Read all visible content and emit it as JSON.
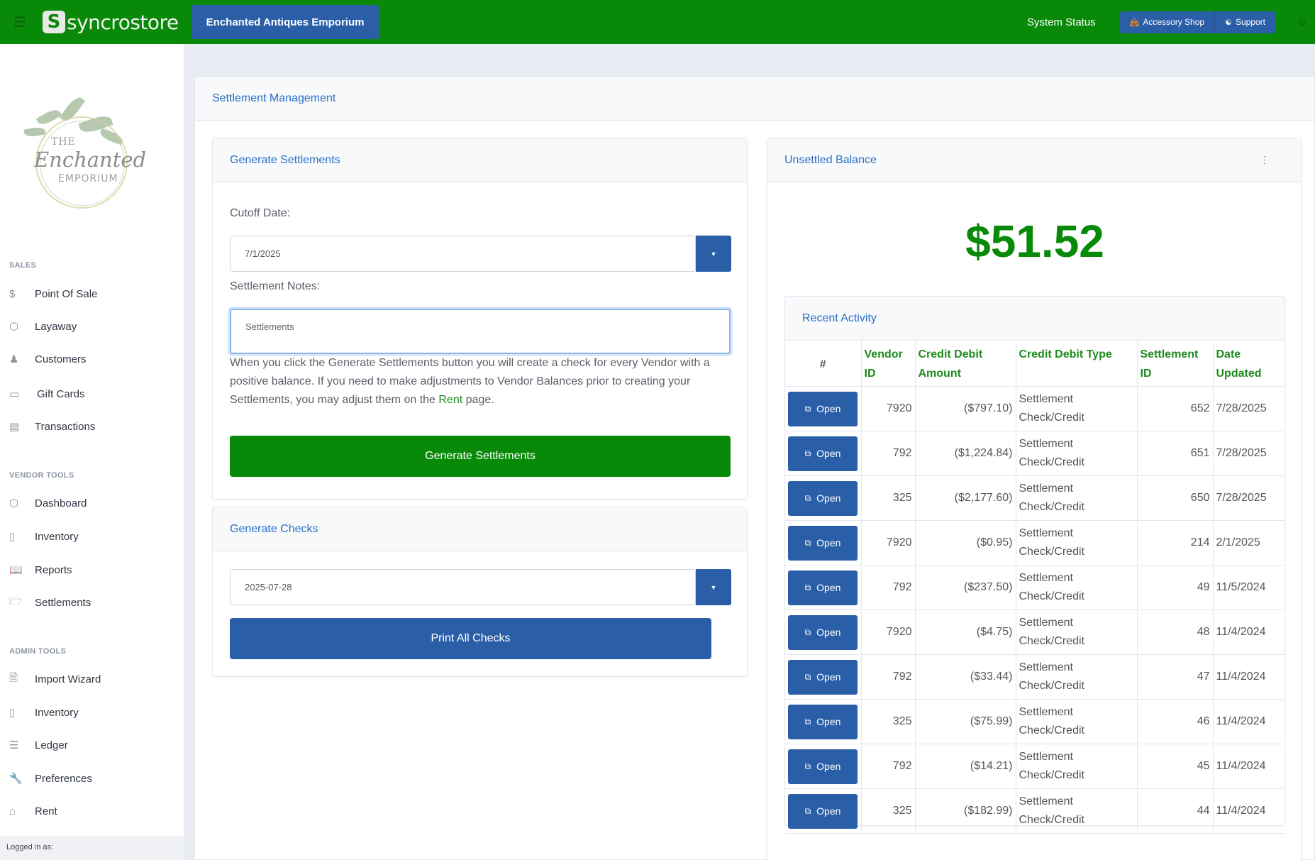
{
  "topbar": {
    "brand": "syncrostore",
    "brand_mark": "S",
    "store_name": "Enchanted Antiques Emporium",
    "system_status": "System Status",
    "accessory_shop": "Accessory Shop",
    "support": "Support",
    "accent": "#088a08",
    "button_color": "#2a5fa8"
  },
  "logo": {
    "the": "THE",
    "enchanted": "Enchanted",
    "emporium": "EMPORIUM"
  },
  "sidebar": {
    "sections": [
      {
        "title": "SALES",
        "items": [
          {
            "label": "Point Of Sale",
            "icon": "dollar-icon"
          },
          {
            "label": "Layaway",
            "icon": "box-icon"
          },
          {
            "label": "Customers",
            "icon": "users-icon"
          },
          {
            "label": "Gift Cards",
            "icon": "card-icon"
          },
          {
            "label": "Transactions",
            "icon": "database-icon"
          }
        ]
      },
      {
        "title": "VENDOR TOOLS",
        "items": [
          {
            "label": "Dashboard",
            "icon": "box-icon"
          },
          {
            "label": "Inventory",
            "icon": "book-icon"
          },
          {
            "label": "Reports",
            "icon": "open-book-icon"
          },
          {
            "label": "Settlements",
            "icon": "folder-icon"
          }
        ]
      },
      {
        "title": "ADMIN TOOLS",
        "items": [
          {
            "label": "Import Wizard",
            "icon": "file-icon"
          },
          {
            "label": "Inventory",
            "icon": "book-icon"
          },
          {
            "label": "Ledger",
            "icon": "layers-icon"
          },
          {
            "label": "Preferences",
            "icon": "wrench-icon"
          },
          {
            "label": "Rent",
            "icon": "home-icon"
          }
        ]
      }
    ],
    "logged_in": "Logged in as:"
  },
  "main": {
    "title": "Settlement Management",
    "generate_settlements": {
      "title": "Generate Settlements",
      "cutoff_label": "Cutoff Date:",
      "cutoff_value": "7/1/2025",
      "notes_label": "Settlement Notes:",
      "notes_value": "Settlements",
      "help_before": "When you click the Generate Settlements button you will create a check for every Vendor with a positive balance. If you need to make adjustments to Vendor Balances prior to creating your Settlements, you may adjust them on the ",
      "help_link": "Rent",
      "help_after": " page.",
      "button": "Generate Settlements"
    },
    "generate_checks": {
      "title": "Generate Checks",
      "date_value": "2025-07-28",
      "button": "Print All Checks"
    },
    "unsettled": {
      "title": "Unsettled Balance",
      "amount": "$51.52"
    },
    "recent_activity": {
      "title": "Recent Activity",
      "columns": [
        "#",
        "Vendor ID",
        "Credit Debit Amount",
        "Credit Debit Type",
        "Settlement ID",
        "Date Updated"
      ],
      "open_label": "Open",
      "rows": [
        {
          "vendor": "7920",
          "amount": "($797.10)",
          "type": "Settlement Check/Credit",
          "sid": "652",
          "date": "7/28/2025"
        },
        {
          "vendor": "792",
          "amount": "($1,224.84)",
          "type": "Settlement Check/Credit",
          "sid": "651",
          "date": "7/28/2025"
        },
        {
          "vendor": "325",
          "amount": "($2,177.60)",
          "type": "Settlement Check/Credit",
          "sid": "650",
          "date": "7/28/2025"
        },
        {
          "vendor": "7920",
          "amount": "($0.95)",
          "type": "Settlement Check/Credit",
          "sid": "214",
          "date": "2/1/2025"
        },
        {
          "vendor": "792",
          "amount": "($237.50)",
          "type": "Settlement Check/Credit",
          "sid": "49",
          "date": "11/5/2024"
        },
        {
          "vendor": "7920",
          "amount": "($4.75)",
          "type": "Settlement Check/Credit",
          "sid": "48",
          "date": "11/4/2024"
        },
        {
          "vendor": "792",
          "amount": "($33.44)",
          "type": "Settlement Check/Credit",
          "sid": "47",
          "date": "11/4/2024"
        },
        {
          "vendor": "325",
          "amount": "($75.99)",
          "type": "Settlement Check/Credit",
          "sid": "46",
          "date": "11/4/2024"
        },
        {
          "vendor": "792",
          "amount": "($14.21)",
          "type": "Settlement Check/Credit",
          "sid": "45",
          "date": "11/4/2024"
        },
        {
          "vendor": "325",
          "amount": "($182.99)",
          "type": "Settlement Check/Credit",
          "sid": "44",
          "date": "11/4/2024"
        }
      ]
    }
  }
}
